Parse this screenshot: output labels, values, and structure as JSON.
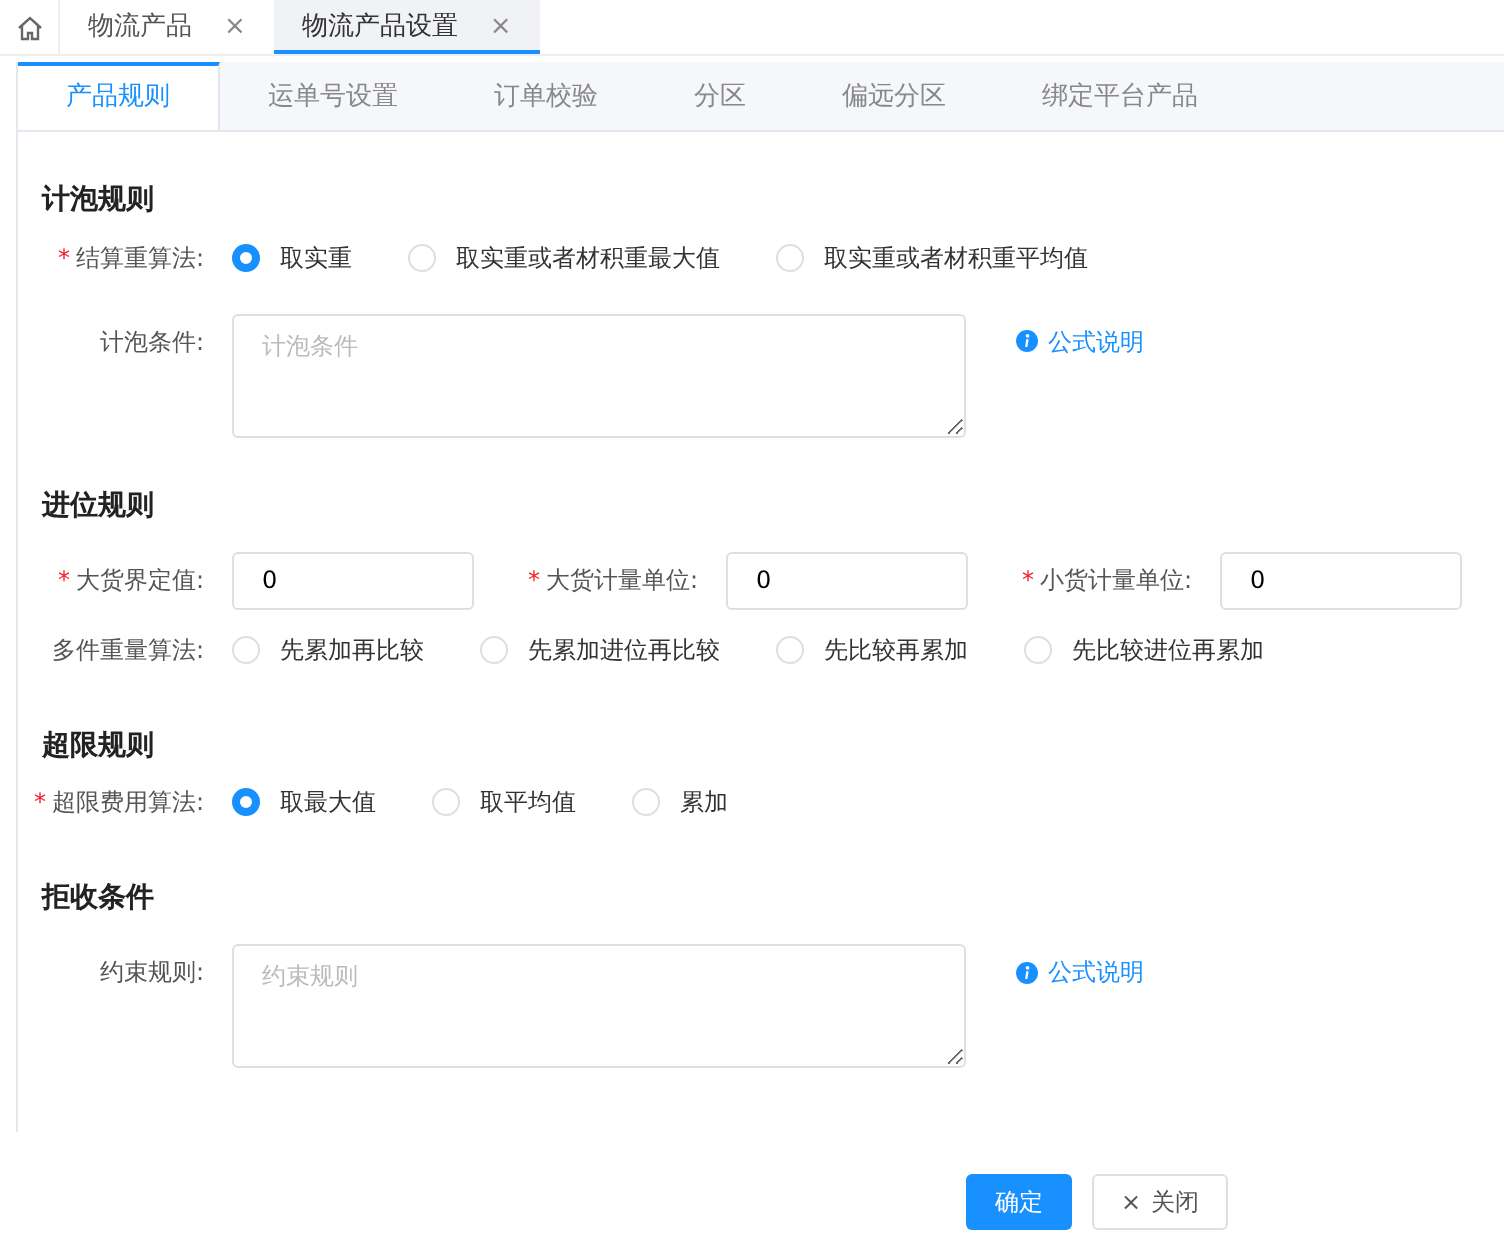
{
  "page_tabs": [
    {
      "label": "物流产品",
      "selected": false,
      "close": "×"
    },
    {
      "label": "物流产品设置",
      "selected": true,
      "close": "×"
    }
  ],
  "sub_tabs": [
    {
      "label": "产品规则",
      "selected": true
    },
    {
      "label": "运单号设置",
      "selected": false
    },
    {
      "label": "订单校验",
      "selected": false
    },
    {
      "label": "分区",
      "selected": false
    },
    {
      "label": "偏远分区",
      "selected": false
    },
    {
      "label": "绑定平台产品",
      "selected": false
    }
  ],
  "sections": [
    {
      "title": "计泡规则",
      "fields": [
        {
          "kind": "radio",
          "mark": "*",
          "label": "结算重算法:",
          "options": [
            {
              "label": "取实重",
              "selected": true
            },
            {
              "label": "取实重或者材积重最大值",
              "selected": false
            },
            {
              "label": "取实重或者材积重平均值",
              "selected": false
            }
          ]
        },
        {
          "kind": "textarea",
          "label": "计泡条件:",
          "placeholder": "计泡条件",
          "help": "公式说明"
        }
      ]
    },
    {
      "title": "进位规则",
      "fields": [
        {
          "kind": "inputs",
          "items": [
            {
              "mark": "*",
              "label": "大货界定值:",
              "value": "0"
            },
            {
              "mark": "*",
              "label": "大货计量单位:",
              "value": "0"
            },
            {
              "mark": "*",
              "label": "小货计量单位:",
              "value": "0"
            }
          ]
        },
        {
          "kind": "radio",
          "label": "多件重量算法:",
          "options": [
            {
              "label": "先累加再比较",
              "selected": false
            },
            {
              "label": "先累加进位再比较",
              "selected": false
            },
            {
              "label": "先比较再累加",
              "selected": false
            },
            {
              "label": "先比较进位再累加",
              "selected": false
            }
          ]
        }
      ]
    },
    {
      "title": "超限规则",
      "fields": [
        {
          "kind": "radio",
          "mark": "*",
          "label": "超限费用算法:",
          "options": [
            {
              "label": "取最大值",
              "selected": true
            },
            {
              "label": "取平均值",
              "selected": false
            },
            {
              "label": "累加",
              "selected": false
            }
          ]
        }
      ]
    },
    {
      "title": "拒收条件",
      "fields": [
        {
          "kind": "textarea",
          "label": "约束规则:",
          "placeholder": "约束规则",
          "help": "公式说明"
        }
      ]
    }
  ],
  "buttons": [
    {
      "kind": "primary",
      "label": "确定"
    },
    {
      "kind": "close",
      "icon": "×",
      "label": "关闭"
    }
  ]
}
